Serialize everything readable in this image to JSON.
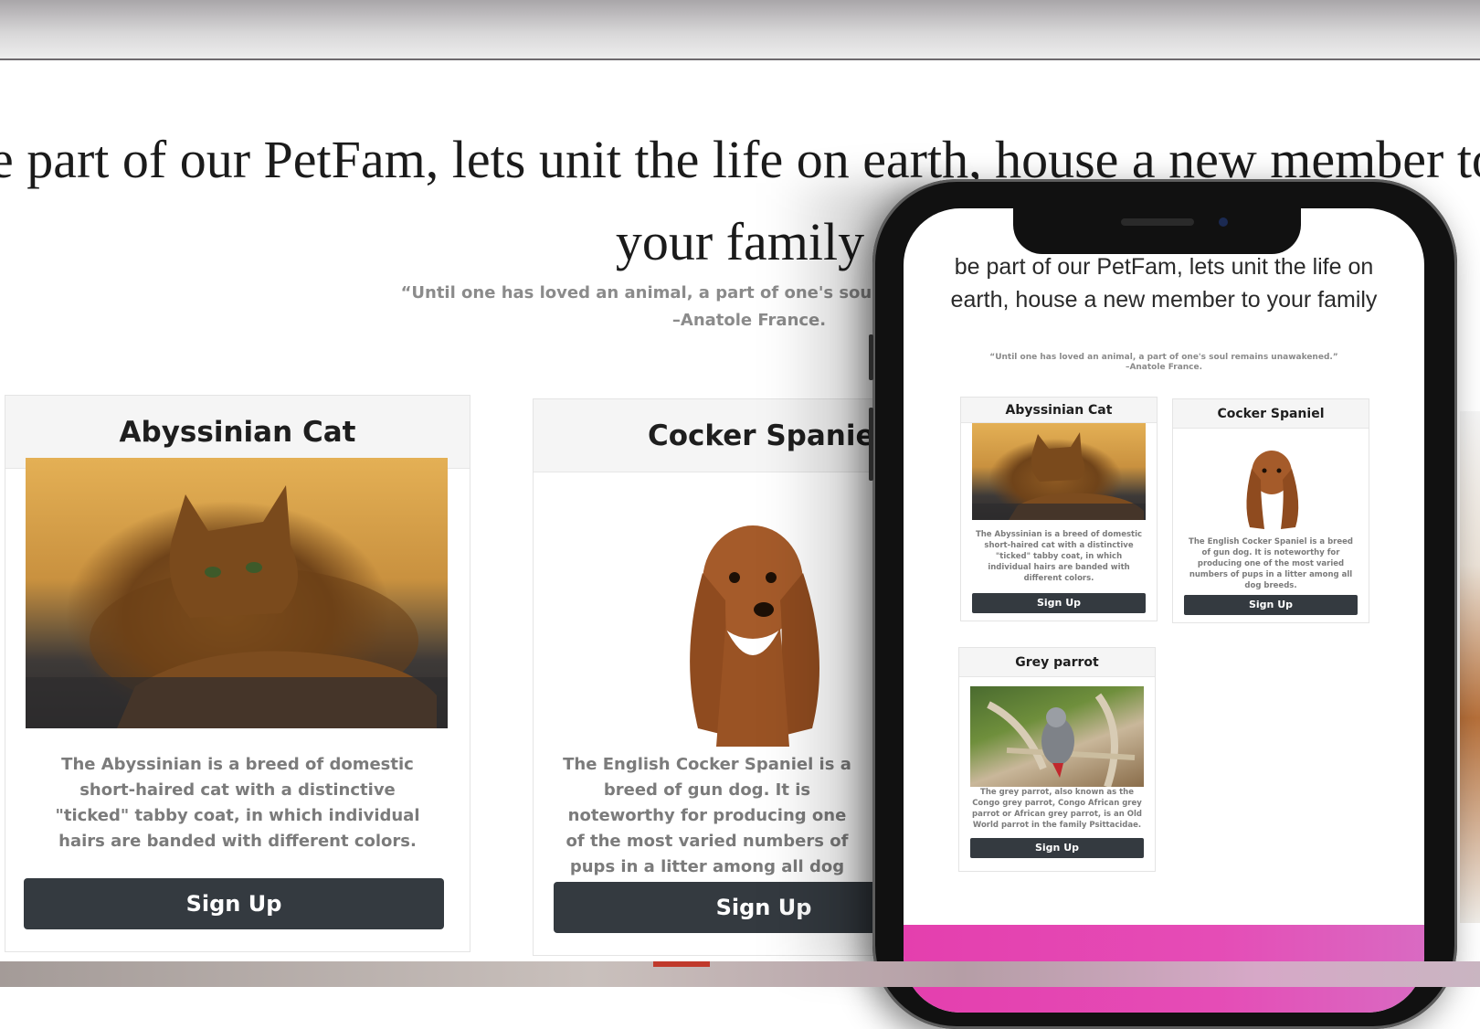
{
  "heading": {
    "line1": "be part of our PetFam, lets unit the life on earth, house a new member to",
    "line2": "your family"
  },
  "quote": {
    "text": "“Until one has loved an animal, a part of one's soul remains unawakened.”",
    "author": "–Anatole France."
  },
  "mobile": {
    "heading": "be part of our PetFam, lets unit the life on earth, house a new member to your family",
    "quote_text": "“Until one has loved an animal, a part of one's soul remains unawakened.”",
    "quote_author": "–Anatole France."
  },
  "cards": [
    {
      "title": "Abyssinian Cat",
      "image": "abyssinian-cat-photo",
      "text": "The Abyssinian is a breed of domestic short-haired cat with a distinctive \"ticked\" tabby coat, in which individual hairs are banded with different colors.",
      "button": "Sign Up"
    },
    {
      "title": "Cocker Spaniel",
      "image": "cocker-spaniel-photo",
      "text": "The English Cocker Spaniel is a breed of gun dog. It is noteworthy for producing one of the most varied numbers of pups in a litter among all dog breeds.",
      "button": "Sign Up"
    },
    {
      "title": "Grey parrot",
      "image": "grey-parrot-photo",
      "text": "The grey parrot, also known as the Congo grey parrot, Congo African grey parrot or African grey parrot, is an Old World parrot in the family Psittacidae.",
      "button": "Sign Up"
    }
  ],
  "colors": {
    "button_bg": "#343a40",
    "footer_pink": "#e43fae",
    "card_header_bg": "#f5f5f5"
  }
}
